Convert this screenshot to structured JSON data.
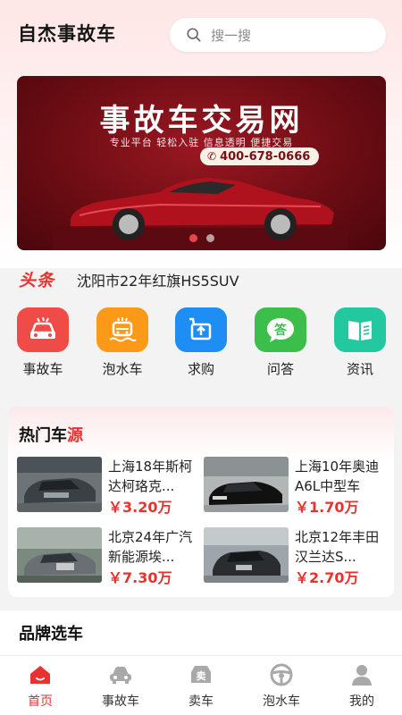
{
  "app": {
    "title": "自杰事故车"
  },
  "search": {
    "placeholder": "搜一搜"
  },
  "banner": {
    "title": "事故车交易网",
    "subtitle": "专业平台  轻松入驻  信息透明  便捷交易",
    "phone": "400-678-0666",
    "slide_count": 2,
    "active_slide": 1
  },
  "headline": {
    "tag": "头条",
    "text": "沈阳市22年红旗HS5SUV"
  },
  "categories": [
    {
      "label": "事故车",
      "icon": "accident-car-icon",
      "color": "#ef4b47"
    },
    {
      "label": "泡水车",
      "icon": "flood-car-icon",
      "color": "#fb9a18"
    },
    {
      "label": "求购",
      "icon": "purchase-icon",
      "color": "#1e8ef5"
    },
    {
      "label": "问答",
      "icon": "qa-icon",
      "color": "#3cbf4a"
    },
    {
      "label": "资讯",
      "icon": "news-icon",
      "color": "#23c7a0"
    }
  ],
  "hot": {
    "title_main": "热门车",
    "title_accent": "源",
    "items": [
      {
        "name": "上海18年斯柯达柯珞克...",
        "price": "￥3.20万"
      },
      {
        "name": "上海10年奥迪A6L中型车",
        "price": "￥1.70万"
      },
      {
        "name": "北京24年广汽新能源埃...",
        "price": "￥7.30万"
      },
      {
        "name": "北京12年丰田汉兰达S...",
        "price": "￥2.70万"
      }
    ]
  },
  "brand": {
    "title": "品牌选车"
  },
  "tabbar": [
    {
      "label": "首页",
      "icon": "home-icon",
      "active": true
    },
    {
      "label": "事故车",
      "icon": "car-icon",
      "active": false
    },
    {
      "label": "卖车",
      "icon": "sell-icon",
      "active": false
    },
    {
      "label": "泡水车",
      "icon": "steering-wheel-icon",
      "active": false
    },
    {
      "label": "我的",
      "icon": "user-icon",
      "active": false
    }
  ],
  "colors": {
    "accent": "#e9312f",
    "banner": "#6d0d14"
  }
}
